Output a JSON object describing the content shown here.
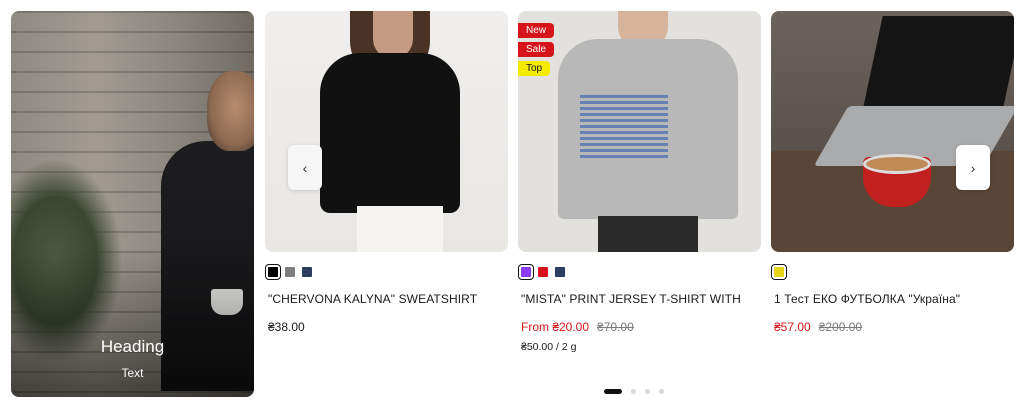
{
  "hero": {
    "heading": "Heading",
    "text": "Text"
  },
  "carousel": {
    "prev_icon": "‹",
    "next_icon": "›",
    "dots_count": 4,
    "active_dot": 0
  },
  "products": [
    {
      "name": "\"CHERVONA KALYNA\" SWEATSHIRT",
      "price": "₴38.00",
      "badges": [],
      "swatches": [
        {
          "color": "#000000",
          "selected": true
        },
        {
          "color": "#7d7d7d",
          "selected": false
        },
        {
          "color": "#2a3d5c",
          "selected": false
        }
      ]
    },
    {
      "name": "\"MISTA\" PRINT JERSEY T-SHIRT WITH",
      "price_sale": "From ₴20.00",
      "price_old": "₴70.00",
      "unit_price": "₴50.00 / 2 g",
      "badges": [
        {
          "label": "New",
          "kind": "new"
        },
        {
          "label": "Sale",
          "kind": "sale"
        },
        {
          "label": "Top",
          "kind": "top"
        }
      ],
      "swatches": [
        {
          "color": "#8a3cf0",
          "selected": true
        },
        {
          "color": "#d7141a",
          "selected": false
        },
        {
          "color": "#2a3d5c",
          "selected": false
        }
      ]
    },
    {
      "name": "1 Тест ЕКО ФУТБОЛКА \"Україна\"",
      "price_sale": "₴57.00",
      "price_old": "₴200.00",
      "badges": [],
      "swatches": [
        {
          "color": "#e6d51a",
          "selected": true
        }
      ]
    }
  ],
  "colors": {
    "sale": "#d7141a",
    "badge_top": "#f5eb00",
    "text": "#1a1a1a"
  }
}
